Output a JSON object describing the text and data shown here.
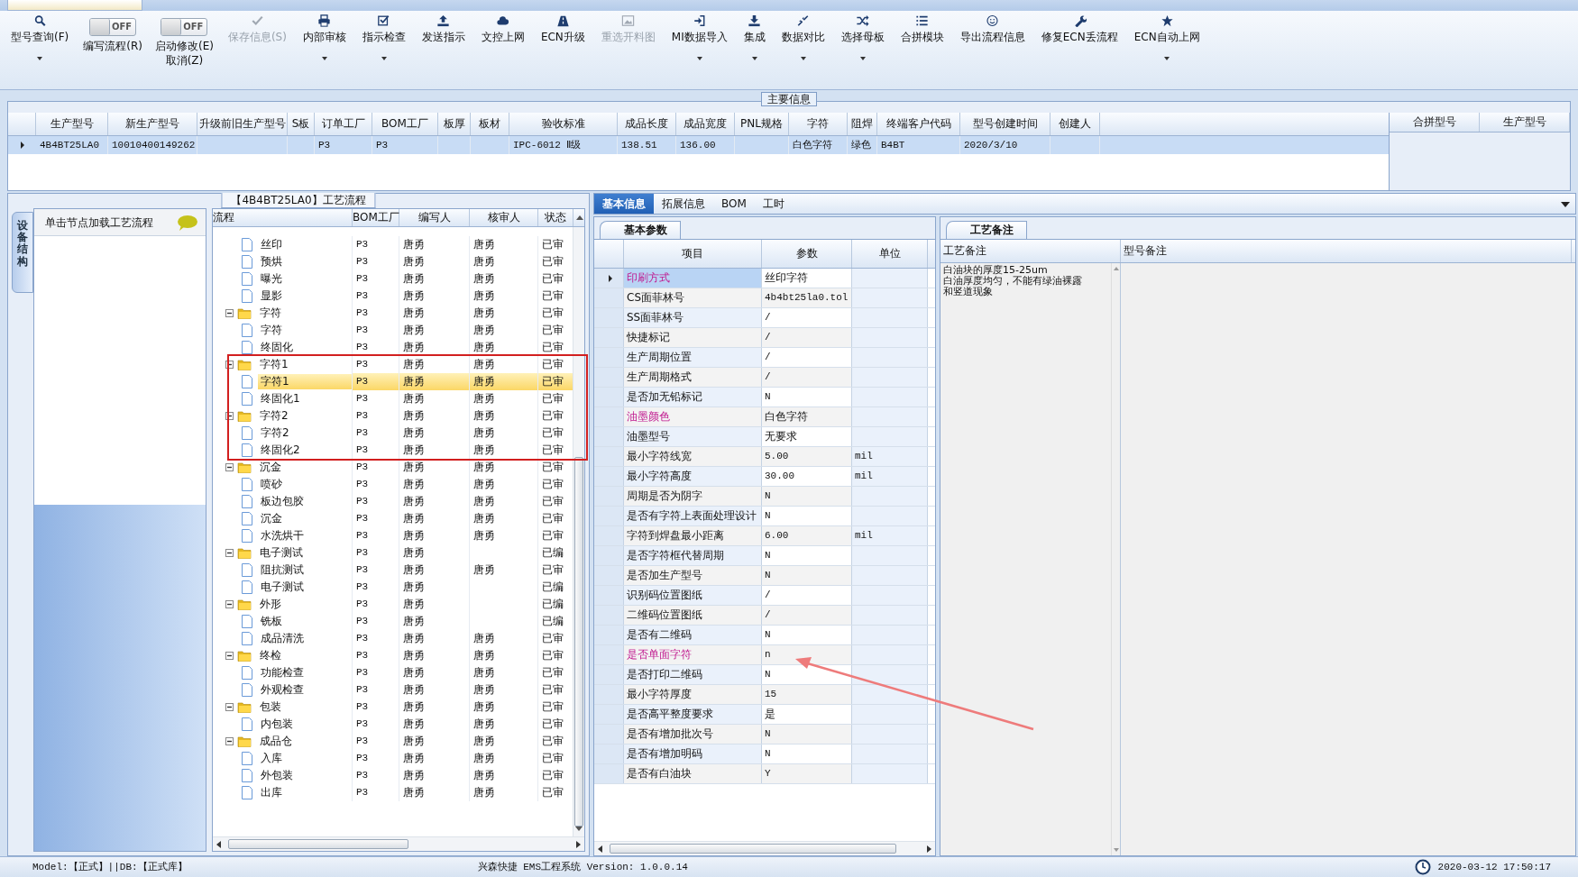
{
  "toolbar": [
    {
      "kind": "button",
      "label": "型号查询(F)",
      "disabled": false,
      "dropdown": true
    },
    {
      "kind": "toggle",
      "text": "OFF",
      "on": false,
      "labels": [
        "编写流程(R)"
      ]
    },
    {
      "kind": "toggle",
      "text": "OFF",
      "on": false,
      "labels": [
        "启动修改(E)",
        "取消(Z)"
      ]
    },
    {
      "kind": "button",
      "label": "保存信息(S)",
      "disabled": true,
      "dropdown": false
    },
    {
      "kind": "button",
      "label": "内部审核",
      "disabled": false,
      "dropdown": true
    },
    {
      "kind": "button",
      "label": "指示检查",
      "disabled": false,
      "dropdown": true
    },
    {
      "kind": "button",
      "label": "发送指示",
      "disabled": false,
      "dropdown": false
    },
    {
      "kind": "button",
      "label": "文控上网",
      "disabled": false,
      "dropdown": false
    },
    {
      "kind": "button",
      "label": "ECN升级",
      "disabled": false,
      "dropdown": false
    },
    {
      "kind": "button",
      "label": "重选开料图",
      "disabled": true,
      "dropdown": false
    },
    {
      "kind": "button",
      "label": "MI数据导入",
      "disabled": false,
      "dropdown": true
    },
    {
      "kind": "button",
      "label": "集成",
      "disabled": false,
      "dropdown": true
    },
    {
      "kind": "button",
      "label": "数据对比",
      "disabled": false,
      "dropdown": true
    },
    {
      "kind": "button",
      "label": "选择母板",
      "disabled": false,
      "dropdown": true
    },
    {
      "kind": "button",
      "label": "合拼模块",
      "disabled": false,
      "dropdown": false
    },
    {
      "kind": "button",
      "label": "导出流程信息",
      "disabled": false,
      "dropdown": false
    },
    {
      "kind": "button",
      "label": "修复ECN丢流程",
      "disabled": false,
      "dropdown": false
    },
    {
      "kind": "button",
      "label": "ECN自动上网",
      "disabled": false,
      "dropdown": true
    }
  ],
  "main_info": {
    "title": "主要信息",
    "columns": [
      "生产型号",
      "新生产型号",
      "升级前旧生产型号",
      "S板",
      "订单工厂",
      "BOM工厂",
      "板厚",
      "板材",
      "验收标准",
      "成品长度",
      "成品宽度",
      "PNL规格",
      "字符",
      "阻焊",
      "终端客户代码",
      "型号创建时间",
      "创建人"
    ],
    "rows": [
      {
        "selected": true,
        "cells": [
          "4B4BT25LA0",
          "10010400149262",
          null,
          null,
          "P3",
          "P3",
          null,
          null,
          "IPC-6012 Ⅱ级",
          "138.51",
          "136.00",
          null,
          "白色字符",
          "绿色",
          "B4BT",
          "2020/3/10",
          null
        ]
      }
    ],
    "merge_columns": [
      "合拼型号",
      "生产型号"
    ]
  },
  "process": {
    "title": "【4B4BT25LA0】工艺流程",
    "side_tab": "设备结构",
    "hint": "单击节点加载工艺流程",
    "columns": [
      "流程",
      "BOM工厂",
      "编写人",
      "核审人",
      "状态"
    ],
    "tree": [
      {
        "children": [
          {
            "label": "丝印",
            "selected": false,
            "bom": "P3",
            "writer": "唐勇",
            "reviewer": "唐勇",
            "status": "已审"
          },
          {
            "label": "预烘",
            "selected": false,
            "bom": "P3",
            "writer": "唐勇",
            "reviewer": "唐勇",
            "status": "已审"
          },
          {
            "label": "曝光",
            "selected": false,
            "bom": "P3",
            "writer": "唐勇",
            "reviewer": "唐勇",
            "status": "已审"
          },
          {
            "label": "显影",
            "selected": false,
            "bom": "P3",
            "writer": "唐勇",
            "reviewer": "唐勇",
            "status": "已审"
          }
        ]
      },
      {
        "label": "字符",
        "selected": false,
        "expanded": true,
        "bom": "P3",
        "writer": "唐勇",
        "reviewer": "唐勇",
        "status": "已审",
        "children": [
          {
            "label": "字符",
            "selected": false,
            "bom": "P3",
            "writer": "唐勇",
            "reviewer": "唐勇",
            "status": "已审"
          },
          {
            "label": "终固化",
            "selected": false,
            "bom": "P3",
            "writer": "唐勇",
            "reviewer": "唐勇",
            "status": "已审"
          }
        ]
      },
      {
        "label": "字符1",
        "selected": false,
        "expanded": true,
        "bom": "P3",
        "writer": "唐勇",
        "reviewer": "唐勇",
        "status": "已审",
        "children": [
          {
            "label": "字符1",
            "selected": true,
            "bom": "P3",
            "writer": "唐勇",
            "reviewer": "唐勇",
            "status": "已审"
          },
          {
            "label": "终固化1",
            "selected": false,
            "bom": "P3",
            "writer": "唐勇",
            "reviewer": "唐勇",
            "status": "已审"
          }
        ]
      },
      {
        "label": "字符2",
        "selected": false,
        "expanded": true,
        "bom": "P3",
        "writer": "唐勇",
        "reviewer": "唐勇",
        "status": "已审",
        "children": [
          {
            "label": "字符2",
            "selected": false,
            "bom": "P3",
            "writer": "唐勇",
            "reviewer": "唐勇",
            "status": "已审"
          },
          {
            "label": "终固化2",
            "selected": false,
            "bom": "P3",
            "writer": "唐勇",
            "reviewer": "唐勇",
            "status": "已审"
          }
        ]
      },
      {
        "label": "沉金",
        "selected": false,
        "expanded": true,
        "bom": "P3",
        "writer": "唐勇",
        "reviewer": "唐勇",
        "status": "已审",
        "children": [
          {
            "label": "喷砂",
            "selected": false,
            "bom": "P3",
            "writer": "唐勇",
            "reviewer": "唐勇",
            "status": "已审"
          },
          {
            "label": "板边包胶",
            "selected": false,
            "bom": "P3",
            "writer": "唐勇",
            "reviewer": "唐勇",
            "status": "已审"
          },
          {
            "label": "沉金",
            "selected": false,
            "bom": "P3",
            "writer": "唐勇",
            "reviewer": "唐勇",
            "status": "已审"
          },
          {
            "label": "水洗烘干",
            "selected": false,
            "bom": "P3",
            "writer": "唐勇",
            "reviewer": "唐勇",
            "status": "已审"
          }
        ]
      },
      {
        "label": "电子测试",
        "selected": false,
        "expanded": true,
        "bom": "P3",
        "writer": "唐勇",
        "status": "已编",
        "children": [
          {
            "label": "阻抗测试",
            "selected": false,
            "bom": "P3",
            "writer": "唐勇",
            "reviewer": "唐勇",
            "status": "已审"
          },
          {
            "label": "电子测试",
            "selected": false,
            "bom": "P3",
            "writer": "唐勇",
            "status": "已编"
          }
        ]
      },
      {
        "label": "外形",
        "selected": false,
        "expanded": true,
        "bom": "P3",
        "writer": "唐勇",
        "status": "已编",
        "children": [
          {
            "label": "铣板",
            "selected": false,
            "bom": "P3",
            "writer": "唐勇",
            "status": "已编"
          },
          {
            "label": "成品清洗",
            "selected": false,
            "bom": "P3",
            "writer": "唐勇",
            "reviewer": "唐勇",
            "status": "已审"
          }
        ]
      },
      {
        "label": "终检",
        "selected": false,
        "expanded": true,
        "bom": "P3",
        "writer": "唐勇",
        "reviewer": "唐勇",
        "status": "已审",
        "children": [
          {
            "label": "功能检查",
            "selected": false,
            "bom": "P3",
            "writer": "唐勇",
            "reviewer": "唐勇",
            "status": "已审"
          },
          {
            "label": "外观检查",
            "selected": false,
            "bom": "P3",
            "writer": "唐勇",
            "reviewer": "唐勇",
            "status": "已审"
          }
        ]
      },
      {
        "label": "包装",
        "selected": false,
        "expanded": true,
        "bom": "P3",
        "writer": "唐勇",
        "reviewer": "唐勇",
        "status": "已审",
        "children": [
          {
            "label": "内包装",
            "selected": false,
            "bom": "P3",
            "writer": "唐勇",
            "reviewer": "唐勇",
            "status": "已审"
          }
        ]
      },
      {
        "label": "成品仓",
        "selected": false,
        "expanded": true,
        "bom": "P3",
        "writer": "唐勇",
        "reviewer": "唐勇",
        "status": "已审",
        "children": [
          {
            "label": "入库",
            "selected": false,
            "bom": "P3",
            "writer": "唐勇",
            "reviewer": "唐勇",
            "status": "已审"
          },
          {
            "label": "外包装",
            "selected": false,
            "bom": "P3",
            "writer": "唐勇",
            "reviewer": "唐勇",
            "status": "已审"
          },
          {
            "label": "出库",
            "selected": false,
            "bom": "P3",
            "writer": "唐勇",
            "reviewer": "唐勇",
            "status": "已审"
          }
        ]
      }
    ]
  },
  "detail": {
    "tabs": [
      {
        "label": "基本信息",
        "selected": true
      },
      {
        "label": "拓展信息",
        "selected": false
      },
      {
        "label": "BOM",
        "selected": false
      },
      {
        "label": "工时",
        "selected": false
      }
    ],
    "params": {
      "tab": "基本参数",
      "columns": [
        "项目",
        "参数",
        "单位"
      ],
      "rows": [
        {
          "item": "印刷方式",
          "value": "丝印字符",
          "highlighted": true,
          "selected": true
        },
        {
          "item": "CS面菲林号",
          "value": "4b4bt25la0.tol",
          "highlighted": false,
          "selected": false
        },
        {
          "item": "SS面菲林号",
          "value": "/",
          "highlighted": false,
          "selected": false
        },
        {
          "item": "快捷标记",
          "value": "/",
          "highlighted": false,
          "selected": false
        },
        {
          "item": "生产周期位置",
          "value": "/",
          "highlighted": false,
          "selected": false
        },
        {
          "item": "生产周期格式",
          "value": "/",
          "highlighted": false,
          "selected": false
        },
        {
          "item": "是否加无铅标记",
          "value": "N",
          "highlighted": false,
          "selected": false
        },
        {
          "item": "油墨颜色",
          "value": "白色字符",
          "highlighted": true,
          "selected": false
        },
        {
          "item": "油墨型号",
          "value": "无要求",
          "highlighted": false,
          "selected": false
        },
        {
          "item": "最小字符线宽",
          "value": "5.00",
          "unit": "mil",
          "highlighted": false,
          "selected": false
        },
        {
          "item": "最小字符高度",
          "value": "30.00",
          "unit": "mil",
          "highlighted": false,
          "selected": false
        },
        {
          "item": "周期是否为阴字",
          "value": "N",
          "highlighted": false,
          "selected": false
        },
        {
          "item": "是否有字符上表面处理设计",
          "value": "N",
          "highlighted": false,
          "selected": false
        },
        {
          "item": "字符到焊盘最小距离",
          "value": "6.00",
          "unit": "mil",
          "highlighted": false,
          "selected": false
        },
        {
          "item": "是否字符框代替周期",
          "value": "N",
          "highlighted": false,
          "selected": false
        },
        {
          "item": "是否加生产型号",
          "value": "N",
          "highlighted": false,
          "selected": false
        },
        {
          "item": "识别码位置图纸",
          "value": "/",
          "highlighted": false,
          "selected": false
        },
        {
          "item": "二维码位置图纸",
          "value": "/",
          "highlighted": false,
          "selected": false
        },
        {
          "item": "是否有二维码",
          "value": "N",
          "highlighted": false,
          "selected": false
        },
        {
          "item": "是否单面字符",
          "value": "n",
          "highlighted": true,
          "selected": false
        },
        {
          "item": "是否打印二维码",
          "value": "N",
          "highlighted": false,
          "selected": false
        },
        {
          "item": "最小字符厚度",
          "value": "15",
          "highlighted": false,
          "selected": false
        },
        {
          "item": "是否高平整度要求",
          "value": "是",
          "highlighted": false,
          "selected": false
        },
        {
          "item": "是否有增加批次号",
          "value": "N",
          "highlighted": false,
          "selected": false
        },
        {
          "item": "是否有增加明码",
          "value": "N",
          "highlighted": false,
          "selected": false
        },
        {
          "item": "是否有白油块",
          "value": "Y",
          "highlighted": false,
          "selected": false
        }
      ]
    },
    "notes": {
      "tab": "工艺备注",
      "columns": [
        "工艺备注",
        "型号备注"
      ],
      "text_lines": [
        "白油块的厚度15-25um",
        "白油厚度均匀，不能有绿油裸露",
        "和竖道现象"
      ]
    }
  },
  "status_bar": {
    "left": "Model:【正式】||DB:【正式库】",
    "center": "兴森快捷 EMS工程系统 Version: 1.0.0.14",
    "time": "2020-03-12 17:50:17"
  }
}
